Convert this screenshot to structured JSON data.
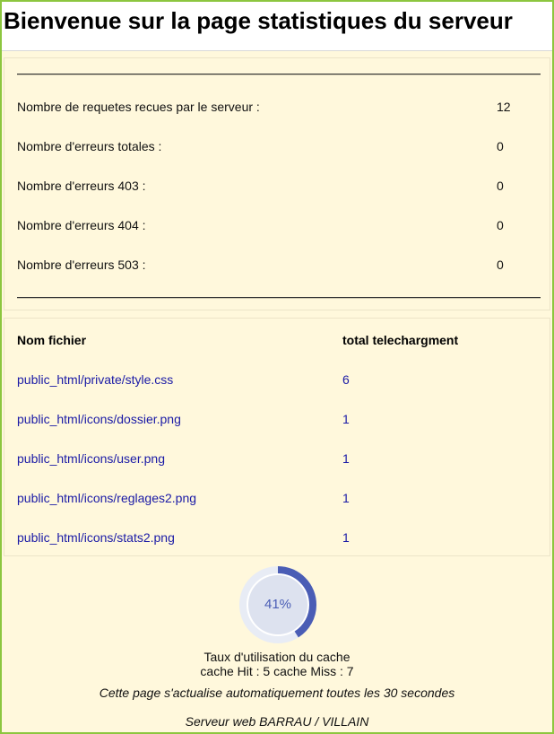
{
  "header": {
    "title": "Bienvenue sur la page statistiques du serveur"
  },
  "stats": {
    "rows": [
      {
        "label": "Nombre de requetes recues par le serveur :",
        "value": "12"
      },
      {
        "label": "Nombre d'erreurs totales :",
        "value": "0"
      },
      {
        "label": "Nombre d'erreurs 403 :",
        "value": "0"
      },
      {
        "label": "Nombre d'erreurs 404 :",
        "value": "0"
      },
      {
        "label": "Nombre d'erreurs 503 :",
        "value": "0"
      }
    ]
  },
  "files": {
    "columns": [
      "Nom fichier",
      "total telechargment"
    ],
    "rows": [
      {
        "name": "public_html/private/style.css",
        "total": "6"
      },
      {
        "name": "public_html/icons/dossier.png",
        "total": "1"
      },
      {
        "name": "public_html/icons/user.png",
        "total": "1"
      },
      {
        "name": "public_html/icons/reglages2.png",
        "total": "1"
      },
      {
        "name": "public_html/icons/stats2.png",
        "total": "1"
      }
    ]
  },
  "cache": {
    "percent": 41,
    "percent_label": "41%",
    "label": "Taux d'utilisation du cache",
    "detail": "cache Hit : 5 cache Miss : 7",
    "ring_color": "#4a5db5",
    "track_color": "#e8ecf5"
  },
  "footer": {
    "refresh_note": "Cette page s'actualise automatiquement toutes les 30 secondes",
    "credit": "Serveur web BARRAU / VILLAIN"
  }
}
